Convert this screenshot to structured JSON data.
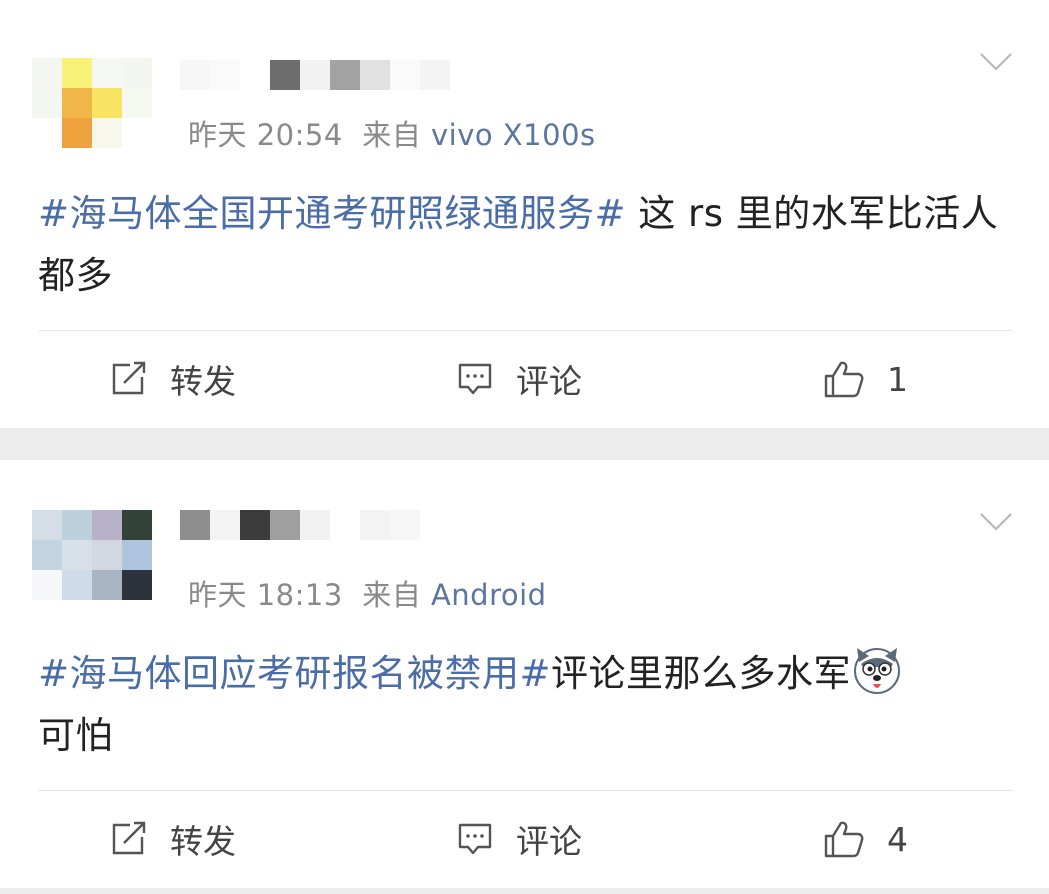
{
  "posts": [
    {
      "time": "昨天 20:54",
      "source_prefix": "来自",
      "source": "vivo X100s",
      "topic": "#海马体全国开通考研照绿通服务#",
      "text": " 这 rs 里的水军比活人都多",
      "actions": {
        "repost": "转发",
        "comment": "评论",
        "like_count": "1"
      }
    },
    {
      "time": "昨天 18:13",
      "source_prefix": "来自",
      "source": "Android",
      "topic": "#海马体回应考研报名被禁用#",
      "text": "评论里那么多水军",
      "text_after_emoji": "可怕",
      "emoji": "husky-emoji",
      "actions": {
        "repost": "转发",
        "comment": "评论",
        "like_count": "4"
      }
    }
  ],
  "colors": {
    "topic": "#4a6da7",
    "source": "#5b76a0",
    "meta": "#8a8a8a",
    "separator": "#ececec"
  },
  "icons": [
    "chevron-down-icon",
    "repost-icon",
    "comment-icon",
    "like-icon"
  ]
}
